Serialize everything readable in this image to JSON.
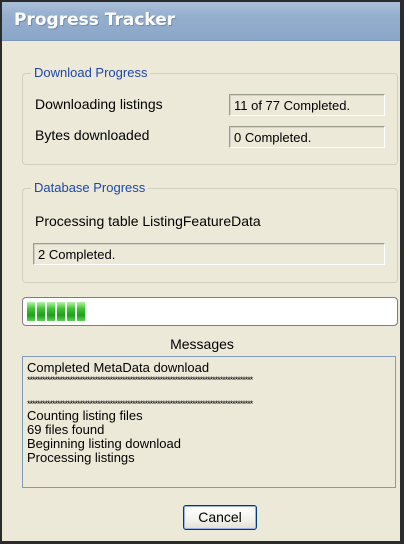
{
  "window": {
    "title": "Progress Tracker"
  },
  "download_progress": {
    "legend": "Download Progress",
    "listings_label": "Downloading listings",
    "listings_value": "11 of 77 Completed.",
    "bytes_label": "Bytes downloaded",
    "bytes_value": "0 Completed."
  },
  "database_progress": {
    "legend": "Database Progress",
    "status_text": "Processing table ListingFeatureData",
    "completed_value": "2 Completed."
  },
  "progress_bar": {
    "fraction": 0.16,
    "color": "#1fa01a"
  },
  "messages": {
    "label": "Messages",
    "lines": [
      "Completed MetaData download",
      "******************************************************************************************",
      "",
      "******************************************************************************************",
      "Counting listing files",
      "69 files found",
      "Beginning listing download",
      "Processing listings"
    ]
  },
  "buttons": {
    "cancel_label": "Cancel"
  }
}
